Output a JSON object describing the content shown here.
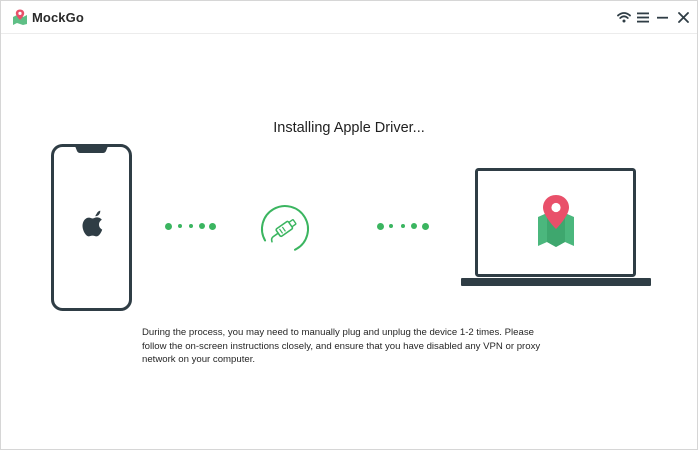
{
  "app": {
    "name": "MockGo"
  },
  "titlebar": {
    "icons": [
      "wifi-icon",
      "menu-icon",
      "minimize-icon",
      "close-icon"
    ]
  },
  "main": {
    "title": "Installing Apple Driver...",
    "description_lines": [
      "During the process, you may need to manually plug and unplug the device 1-2 times. Please",
      "follow the on-screen instructions closely, and ensure that you have disabled any VPN or proxy",
      "network on your computer."
    ]
  },
  "colors": {
    "accent": "#3bb560",
    "device": "#2f3d45",
    "pin": "#e9506a",
    "map": "#4bb77d"
  }
}
